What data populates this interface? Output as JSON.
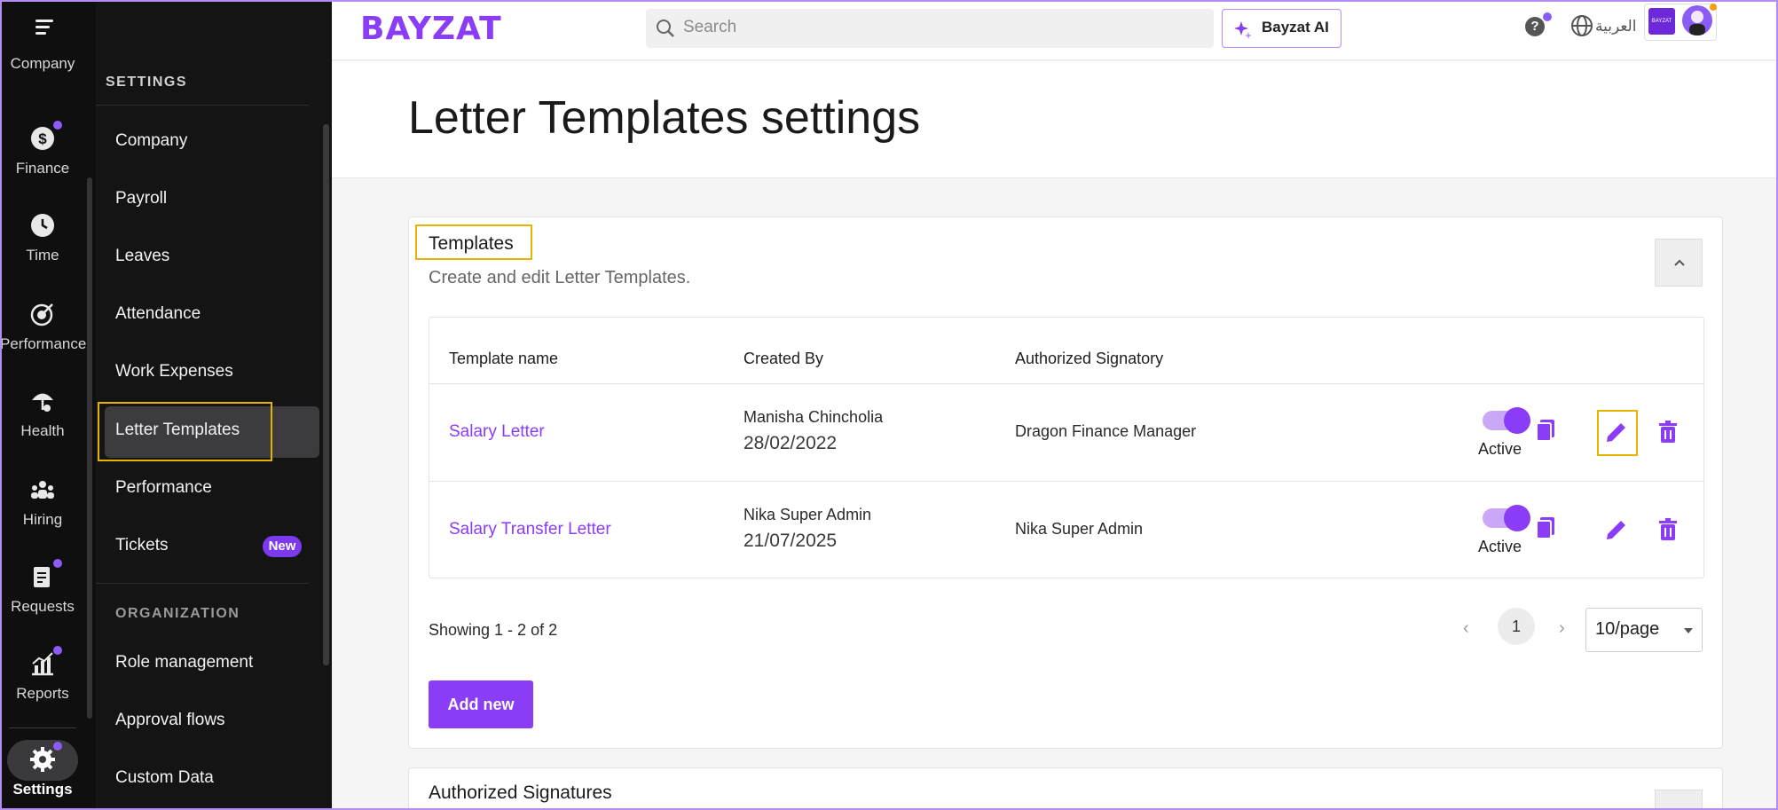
{
  "rail": {
    "items": [
      {
        "label": "Company",
        "icon": "building-icon"
      },
      {
        "label": "Finance",
        "icon": "dollar-icon"
      },
      {
        "label": "Time",
        "icon": "clock-icon"
      },
      {
        "label": "Performance",
        "icon": "target-icon"
      },
      {
        "label": "Health",
        "icon": "umbrella-heart-icon"
      },
      {
        "label": "Hiring",
        "icon": "people-icon"
      },
      {
        "label": "Requests",
        "icon": "clipboard-icon"
      },
      {
        "label": "Reports",
        "icon": "chart-icon"
      },
      {
        "label": "Settings",
        "icon": "gear-icon"
      }
    ]
  },
  "sidebar": {
    "heading": "SETTINGS",
    "items": [
      {
        "label": "Company"
      },
      {
        "label": "Payroll"
      },
      {
        "label": "Leaves"
      },
      {
        "label": "Attendance"
      },
      {
        "label": "Work Expenses"
      },
      {
        "label": "Letter Templates"
      },
      {
        "label": "Performance"
      },
      {
        "label": "Tickets",
        "badge": "New"
      }
    ],
    "org_heading": "ORGANIZATION",
    "org_items": [
      {
        "label": "Role management"
      },
      {
        "label": "Approval flows"
      },
      {
        "label": "Custom Data"
      }
    ]
  },
  "topbar": {
    "brand": "BAYZAT",
    "search_placeholder": "Search",
    "ai_label": "Bayzat AI",
    "help": "?",
    "language": "العربية",
    "company_logo_text": "BAYZAT"
  },
  "page": {
    "title": "Letter Templates settings"
  },
  "templates": {
    "title": "Templates",
    "subtitle": "Create and edit Letter Templates.",
    "columns": [
      "Template name",
      "Created By",
      "Authorized Signatory"
    ],
    "rows": [
      {
        "name": "Salary Letter",
        "created_by": "Manisha Chincholia",
        "date": "28/02/2022",
        "signatory": "Dragon Finance Manager",
        "status": "Active"
      },
      {
        "name": "Salary Transfer Letter",
        "created_by": "Nika Super Admin",
        "date": "21/07/2025",
        "signatory": "Nika Super Admin",
        "status": "Active"
      }
    ],
    "showing": "Showing 1 - 2 of 2",
    "page": "1",
    "per_page": "10/page",
    "add_label": "Add new"
  },
  "signatures": {
    "title": "Authorized Signatures"
  },
  "colors": {
    "accent": "#8b3cf7",
    "highlight": "#e8b300",
    "rail_bg": "#0f0f10"
  }
}
